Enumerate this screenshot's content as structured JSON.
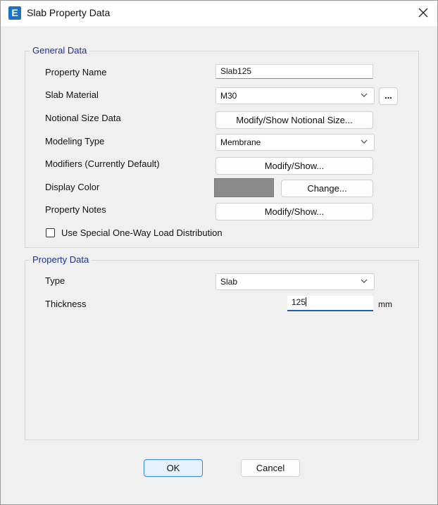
{
  "window": {
    "title": "Slab Property Data",
    "app_icon_letter": "E"
  },
  "general": {
    "legend": "General Data",
    "property_name_label": "Property Name",
    "property_name_value": "Slab125",
    "slab_material_label": "Slab Material",
    "slab_material_value": "M30",
    "material_more_label": "...",
    "notional_label": "Notional Size Data",
    "notional_button": "Modify/Show Notional Size...",
    "modeling_label": "Modeling Type",
    "modeling_value": "Membrane",
    "modifiers_label": "Modifiers (Currently Default)",
    "modifiers_button": "Modify/Show...",
    "display_color_label": "Display Color",
    "display_color_value": "#8a8a8a",
    "change_button": "Change...",
    "notes_label": "Property Notes",
    "notes_button": "Modify/Show...",
    "one_way_label": "Use Special One-Way Load Distribution",
    "one_way_checked": false
  },
  "property": {
    "legend": "Property Data",
    "type_label": "Type",
    "type_value": "Slab",
    "thickness_label": "Thickness",
    "thickness_value": "125",
    "thickness_unit": "mm"
  },
  "footer": {
    "ok": "OK",
    "cancel": "Cancel"
  },
  "icons": {
    "close": "close-icon",
    "chevron": "chevron-down-icon"
  },
  "colors": {
    "accent": "#1a5fb4",
    "legend": "#1f2f9a",
    "app_icon": "#1a73c8"
  }
}
